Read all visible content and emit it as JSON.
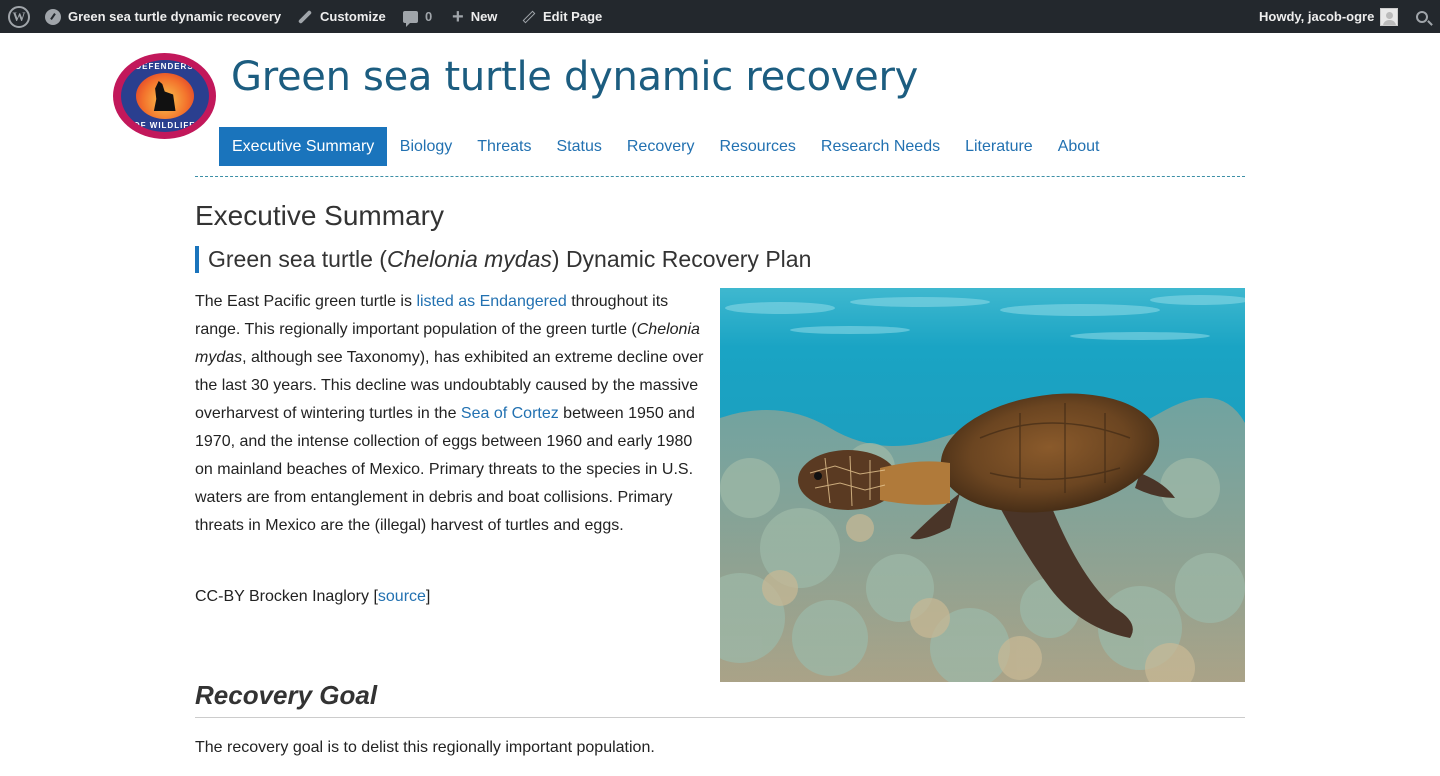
{
  "adminbar": {
    "site_name": "Green sea turtle dynamic recovery",
    "customize": "Customize",
    "comments_count": "0",
    "new": "New",
    "edit_page": "Edit Page",
    "howdy": "Howdy, jacob-ogre",
    "icons": [
      "wordpress-icon",
      "dashboard-icon",
      "brush-icon",
      "comment-icon",
      "plus-icon",
      "pencil-icon",
      "avatar-icon",
      "search-icon"
    ],
    "background": "#23282d"
  },
  "logo": {
    "top_text": "DEFENDERS",
    "bottom_text": "OF WILDLIFE"
  },
  "site_title": "Green sea turtle dynamic recovery",
  "nav": {
    "items": [
      "Executive Summary",
      "Biology",
      "Threats",
      "Status",
      "Recovery",
      "Resources",
      "Research Needs",
      "Literature",
      "About"
    ],
    "active": "Executive Summary",
    "accent": "#1a74bc"
  },
  "content": {
    "page_title": "Executive Summary",
    "subtitle_pre": "Green sea turtle (",
    "subtitle_italic": "Chelonia mydas",
    "subtitle_post": ") Dynamic Recovery Plan",
    "p1_a": "The East Pacific green turtle is ",
    "p1_link1": "listed as Endangered",
    "p1_b": " throughout its range. This regionally important population of the green turtle (",
    "p1_italic": "Chelonia mydas",
    "p1_c": ", although see Taxonomy), has exhibited an extreme decline over the last 30 years. This decline was undoubtably caused by the massive overharvest of wintering turtles in the ",
    "p1_link2": "Sea of Cortez",
    "p1_d": " between 1950 and 1970, and the intense collection of eggs between 1960 and early 1980 on mainland beaches of Mexico. Primary threats to the species in U.S. waters are from entanglement in debris and boat collisions. Primary threats in Mexico are the (illegal) harvest of turtles and eggs.",
    "credit_pre": "CC-BY Brocken Inaglory [",
    "credit_link": "source",
    "credit_post": "]",
    "goal_title": "Recovery Goal",
    "goal_text": "The recovery goal is to delist this regionally important population."
  },
  "link_color": "#2271b1"
}
